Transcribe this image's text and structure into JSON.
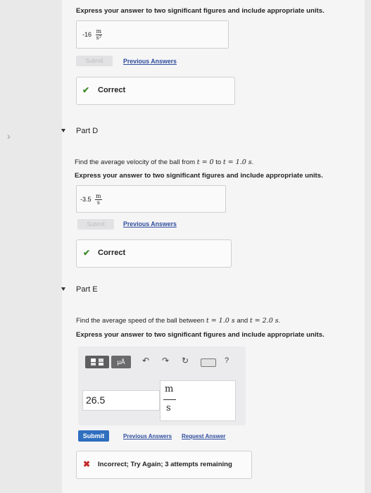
{
  "partC": {
    "instruction": "Express your answer to two significant figures and include appropriate units.",
    "value": "-16",
    "unit_num": "m",
    "unit_den": "s²",
    "submit": "Submit",
    "previous": "Previous Answers",
    "feedback": "Correct"
  },
  "partD": {
    "title": "Part D",
    "question_prefix": "Find the average velocity of the ball from",
    "t1": "t = 0",
    "to": "to",
    "t2": "t = 1.0 s",
    "period": ".",
    "instruction": "Express your answer to two significant figures and include appropriate units.",
    "value": "-3.5",
    "unit_num": "m",
    "unit_den": "s",
    "submit": "Submit",
    "previous": "Previous Answers",
    "feedback": "Correct"
  },
  "partE": {
    "title": "Part E",
    "question_prefix": "Find the average speed of the ball between",
    "t1": "t = 1.0 s",
    "and": "and",
    "t2": "t = 2.0 s",
    "period": ".",
    "instruction": "Express your answer to two significant figures and include appropriate units.",
    "toolbar": {
      "units_label": "μÅ",
      "help": "?"
    },
    "value": "26.5",
    "unit_num": "m",
    "unit_den": "s",
    "submit": "Submit",
    "previous": "Previous Answers",
    "request": "Request Answer",
    "feedback": "Incorrect; Try Again; 3 attempts remaining"
  },
  "colors": {
    "submit_blue": "#2f6fbf",
    "correct_green": "#3f8a2a",
    "incorrect_red": "#c62828",
    "link_blue": "#2d4c9c"
  }
}
